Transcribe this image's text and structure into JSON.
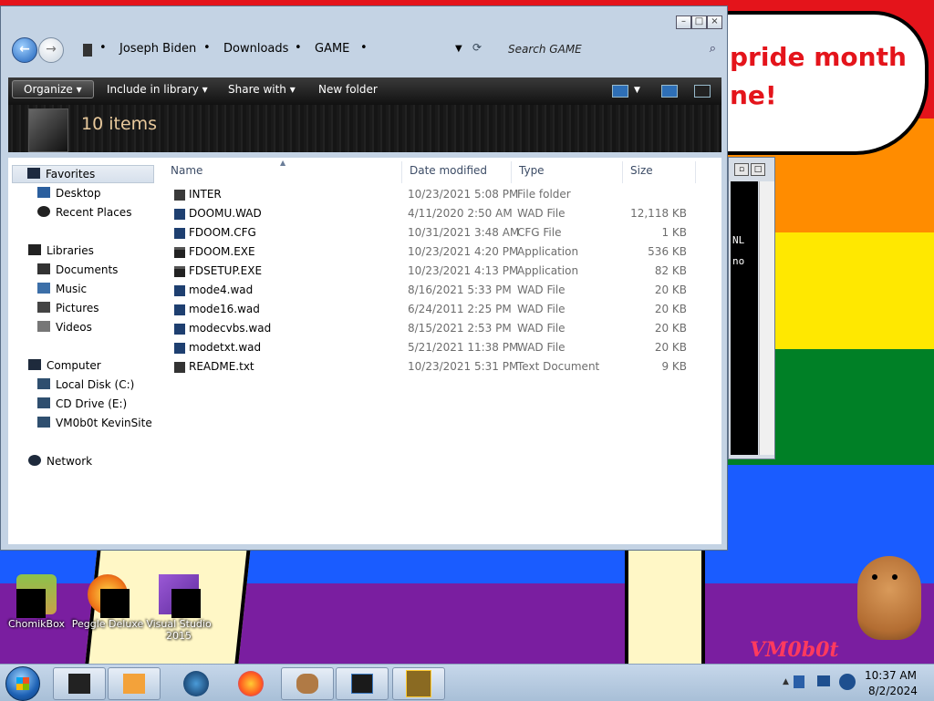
{
  "wallpaper": {
    "bubble_text_line1": "pride month",
    "bubble_text_line2": "ne!",
    "brand_text": "VM0b0t",
    "dos_text_1": "NL",
    "dos_text_2": "no"
  },
  "desktop_icons": [
    {
      "label": "ChomikBox",
      "icon": "chomikbox-icon"
    },
    {
      "label": "Peggle Deluxe",
      "icon": "peggle-icon"
    },
    {
      "label": "Visual Studio 2015",
      "icon": "visual-studio-icon"
    }
  ],
  "explorer": {
    "breadcrumbs": [
      "Joseph Biden",
      "Downloads",
      "GAME"
    ],
    "search_placeholder": "Search GAME",
    "toolbar": {
      "organize": "Organize",
      "include_in_library": "Include in library",
      "share_with": "Share with",
      "new_folder": "New folder"
    },
    "items_count": "10 items",
    "nav": {
      "favorites": "Favorites",
      "desktop": "Desktop",
      "recent_places": "Recent Places",
      "libraries": "Libraries",
      "documents": "Documents",
      "music": "Music",
      "pictures": "Pictures",
      "videos": "Videos",
      "computer": "Computer",
      "local_disk": "Local Disk (C:)",
      "cd_drive": "CD Drive (E:)",
      "network_drive": "VM0b0t KevinSite",
      "network": "Network"
    },
    "columns": {
      "name": "Name",
      "date": "Date modified",
      "type": "Type",
      "size": "Size"
    },
    "files": [
      {
        "name": "INTER",
        "date": "10/23/2021 5:08 PM",
        "type": "File folder",
        "size": "",
        "icon": "folder-icon"
      },
      {
        "name": "DOOMU.WAD",
        "date": "4/11/2020 2:50 AM",
        "type": "WAD File",
        "size": "12,118 KB",
        "icon": "wad-file-icon"
      },
      {
        "name": "FDOOM.CFG",
        "date": "10/31/2021 3:48 AM",
        "type": "CFG File",
        "size": "1 KB",
        "icon": "cfg-file-icon"
      },
      {
        "name": "FDOOM.EXE",
        "date": "10/23/2021 4:20 PM",
        "type": "Application",
        "size": "536 KB",
        "icon": "application-icon"
      },
      {
        "name": "FDSETUP.EXE",
        "date": "10/23/2021 4:13 PM",
        "type": "Application",
        "size": "82 KB",
        "icon": "application-icon"
      },
      {
        "name": "mode4.wad",
        "date": "8/16/2021 5:33 PM",
        "type": "WAD File",
        "size": "20 KB",
        "icon": "wad-file-icon"
      },
      {
        "name": "mode16.wad",
        "date": "6/24/2011 2:25 PM",
        "type": "WAD File",
        "size": "20 KB",
        "icon": "wad-file-icon"
      },
      {
        "name": "modecvbs.wad",
        "date": "8/15/2021 2:53 PM",
        "type": "WAD File",
        "size": "20 KB",
        "icon": "wad-file-icon"
      },
      {
        "name": "modetxt.wad",
        "date": "5/21/2021 11:38 PM",
        "type": "WAD File",
        "size": "20 KB",
        "icon": "wad-file-icon"
      },
      {
        "name": "README.txt",
        "date": "10/23/2021 5:31 PM",
        "type": "Text Document",
        "size": "9 KB",
        "icon": "text-document-icon"
      }
    ]
  },
  "taskbar": {
    "time": "10:37 AM",
    "date": "8/2/2024",
    "pinned": [
      "explorer-icon",
      "media-player-icon",
      "globe-icon",
      "firefox-icon",
      "hamster-icon",
      "window-icon",
      "dosbox-icon"
    ]
  }
}
